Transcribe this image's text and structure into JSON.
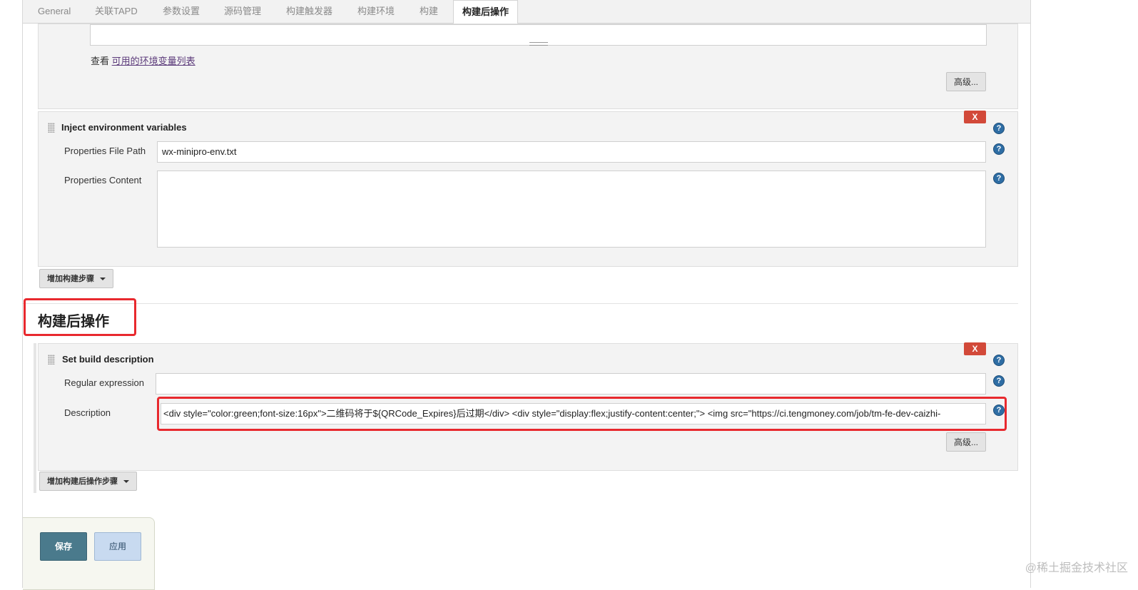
{
  "tabs": [
    "General",
    "关联TAPD",
    "参数设置",
    "源码管理",
    "构建触发器",
    "构建环境",
    "构建",
    "构建后操作"
  ],
  "active_tab_index": 7,
  "env_vars_hint": {
    "prefix": "查看",
    "link": "可用的环境变量列表"
  },
  "advanced_label": "高级...",
  "inject_env": {
    "title": "Inject environment variables",
    "delete_label": "X",
    "properties_file_path_label": "Properties File Path",
    "properties_file_path_value": "wx-minipro-env.txt",
    "properties_content_label": "Properties Content",
    "properties_content_value": ""
  },
  "add_build_step_label": "增加构建步骤",
  "post_build_heading": "构建后操作",
  "set_build_description": {
    "title": "Set build description",
    "delete_label": "X",
    "regex_label": "Regular expression",
    "regex_value": "",
    "description_label": "Description",
    "description_value": "<div style=\"color:green;font-size:16px\">二维码将于${QRCode_Expires}后过期</div> <div style=\"display:flex;justify-content:center;\"> <img src=\"https://ci.tengmoney.com/job/tm-fe-dev-caizhi-",
    "advanced_label": "高级..."
  },
  "add_post_build_step_label": "增加构建后操作步骤",
  "save_label": "保存",
  "apply_label": "应用",
  "help_glyph": "?",
  "watermark": "@稀土掘金技术社区",
  "colors": {
    "highlight_frame": "#e8292e",
    "delete_button": "#d24939",
    "save_button": "#4a7a8c"
  }
}
